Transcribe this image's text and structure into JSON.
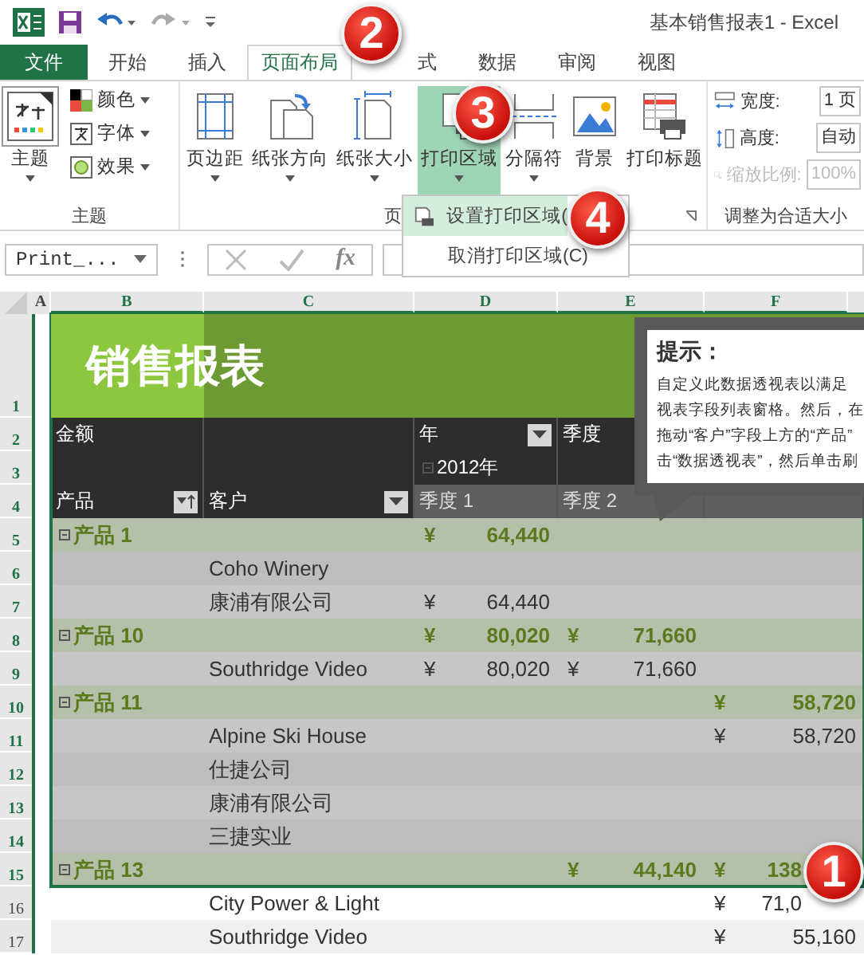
{
  "title_bar": {
    "title": "基本销售报表1 - Excel"
  },
  "tabs": [
    {
      "label": "文件",
      "kind": "file",
      "selected": false
    },
    {
      "label": "开始",
      "kind": "tab",
      "selected": false
    },
    {
      "label": "插入",
      "kind": "tab",
      "selected": false
    },
    {
      "label": "页面布局",
      "kind": "tab",
      "selected": true
    },
    {
      "label": "式",
      "kind": "tab",
      "selected": false
    },
    {
      "label": "数据",
      "kind": "tab",
      "selected": false
    },
    {
      "label": "审阅",
      "kind": "tab",
      "selected": false
    },
    {
      "label": "视图",
      "kind": "tab",
      "selected": false
    }
  ],
  "ribbon": {
    "theme_group": {
      "label": "主题",
      "big_button": "主题",
      "small_buttons": [
        "颜色",
        "字体",
        "效果"
      ]
    },
    "page_setup_group": {
      "label": "页",
      "buttons": [
        {
          "label": "页边距",
          "selected": false
        },
        {
          "label": "纸张方向",
          "selected": false
        },
        {
          "label": "纸张大小",
          "selected": false
        },
        {
          "label": "打印区域",
          "selected": true
        },
        {
          "label": "分隔符",
          "selected": false
        },
        {
          "label": "背景",
          "selected": false
        },
        {
          "label": "打印标题",
          "selected": false
        }
      ]
    },
    "scale_group": {
      "label": "调整为合适大小",
      "fields": [
        {
          "label": "宽度:",
          "value": "1 页",
          "disabled": false
        },
        {
          "label": "高度:",
          "value": "自动",
          "disabled": false
        },
        {
          "label": "缩放比例:",
          "value": "100%",
          "disabled": true
        }
      ]
    }
  },
  "dropdown_menu": {
    "items": [
      {
        "label": "设置打印区域(",
        "selected": true
      },
      {
        "label": "取消打印区域(C)",
        "selected": false
      }
    ]
  },
  "formula_bar": {
    "name_box": "Print_...",
    "fx": "fx"
  },
  "sheet": {
    "columns": [
      {
        "label": "A",
        "selected": false
      },
      {
        "label": "B",
        "selected": true
      },
      {
        "label": "C",
        "selected": true
      },
      {
        "label": "D",
        "selected": true
      },
      {
        "label": "E",
        "selected": true
      },
      {
        "label": "F",
        "selected": true
      }
    ],
    "rows": [
      {
        "num": "1",
        "kind": "title",
        "in_print_area": true,
        "title": "销售报表"
      },
      {
        "num": "2",
        "kind": "header",
        "in_print_area": true,
        "cells": [
          {
            "text": "金额"
          },
          {},
          {
            "text": "年",
            "filter": true,
            "sorted": false
          },
          {
            "text": "季度"
          },
          {}
        ]
      },
      {
        "num": "3",
        "kind": "header",
        "in_print_area": true,
        "cells": [
          {},
          {},
          {
            "text": "2012年",
            "collapse": true
          },
          {},
          {}
        ]
      },
      {
        "num": "4",
        "kind": "header",
        "in_print_area": true,
        "cells": [
          {
            "text": "产品",
            "filter": true,
            "sorted": true
          },
          {
            "text": "客户",
            "filter": true,
            "sorted": false
          },
          {
            "text": "季度 1",
            "shaded": true
          },
          {
            "text": "季度 2",
            "shaded": true
          },
          {
            "shaded": true
          }
        ]
      },
      {
        "num": "5",
        "kind": "group",
        "in_print_area": true,
        "cells": [
          {
            "text": "产品 1",
            "collapse": true
          },
          {},
          {
            "yen": "¥",
            "value": "64,440"
          },
          {},
          {}
        ]
      },
      {
        "num": "6",
        "kind": "detail",
        "in_print_area": true,
        "cells": [
          {},
          {
            "text": "Coho Winery"
          },
          {},
          {},
          {}
        ]
      },
      {
        "num": "7",
        "kind": "detail",
        "in_print_area": true,
        "cells": [
          {},
          {
            "text": "康浦有限公司"
          },
          {
            "yen": "¥",
            "value": "64,440"
          },
          {},
          {}
        ]
      },
      {
        "num": "8",
        "kind": "group",
        "in_print_area": true,
        "cells": [
          {
            "text": "产品 10",
            "collapse": true
          },
          {},
          {
            "yen": "¥",
            "value": "80,020"
          },
          {
            "yen": "¥",
            "value": "71,660"
          },
          {}
        ]
      },
      {
        "num": "9",
        "kind": "detail",
        "in_print_area": true,
        "cells": [
          {},
          {
            "text": "Southridge Video"
          },
          {
            "yen": "¥",
            "value": "80,020"
          },
          {
            "yen": "¥",
            "value": "71,660"
          },
          {}
        ]
      },
      {
        "num": "10",
        "kind": "group",
        "in_print_area": true,
        "cells": [
          {
            "text": "产品 11",
            "collapse": true
          },
          {},
          {},
          {},
          {
            "yen": "¥",
            "value": "58,720"
          }
        ]
      },
      {
        "num": "11",
        "kind": "detail",
        "in_print_area": true,
        "cells": [
          {},
          {
            "text": "Alpine Ski House"
          },
          {},
          {},
          {
            "yen": "¥",
            "value": "58,720"
          }
        ]
      },
      {
        "num": "12",
        "kind": "detail",
        "in_print_area": true,
        "cells": [
          {},
          {
            "text": "仕捷公司"
          },
          {},
          {},
          {}
        ]
      },
      {
        "num": "13",
        "kind": "detail",
        "in_print_area": true,
        "cells": [
          {},
          {
            "text": "康浦有限公司"
          },
          {},
          {},
          {}
        ]
      },
      {
        "num": "14",
        "kind": "detail",
        "in_print_area": true,
        "cells": [
          {},
          {
            "text": "三捷实业"
          },
          {},
          {},
          {}
        ]
      },
      {
        "num": "15",
        "kind": "group",
        "in_print_area": true,
        "cells": [
          {
            "text": "产品 13",
            "collapse": true
          },
          {},
          {},
          {
            "yen": "¥",
            "value": "44,140"
          },
          {
            "yen": "¥",
            "value": "138"
          }
        ]
      },
      {
        "num": "16",
        "kind": "detail",
        "in_print_area": false,
        "cells": [
          {},
          {
            "text": "City Power & Light"
          },
          {},
          {},
          {
            "yen": "¥",
            "value": "71,0"
          }
        ]
      },
      {
        "num": "17",
        "kind": "detail",
        "in_print_area": false,
        "cells": [
          {},
          {
            "text": "Southridge Video"
          },
          {},
          {},
          {
            "yen": "¥",
            "value": "55,160"
          }
        ]
      }
    ]
  },
  "tooltip": {
    "title": "提示：",
    "lines": [
      "自定义此数据透视表以满足",
      "视表字段列表窗格。然后，在",
      "拖动“客户”字段上方的“产品”",
      "击“数据透视表”，然后单击刷"
    ]
  },
  "step_badges": [
    {
      "number": "2"
    },
    {
      "number": "3"
    },
    {
      "number": "4"
    },
    {
      "number": "1"
    }
  ]
}
